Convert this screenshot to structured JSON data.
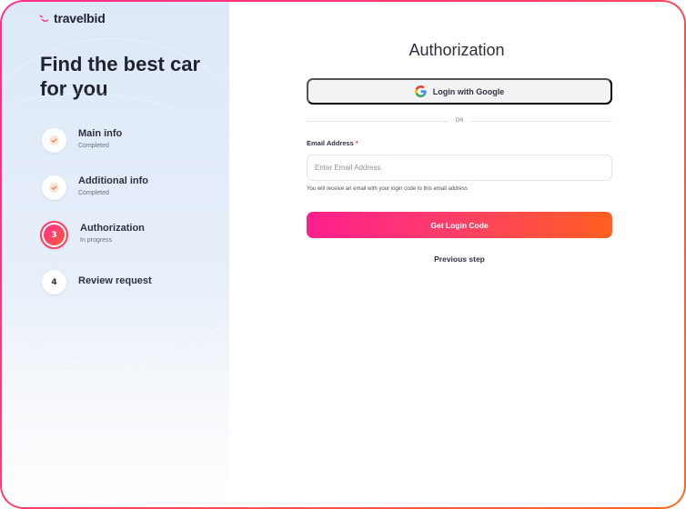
{
  "brand": {
    "name": "travelbid",
    "accent": "#ff3c63",
    "gradient_start": "#ff1f8e",
    "gradient_end": "#ff5f20"
  },
  "sidebar": {
    "headline": "Find the best car for you",
    "steps": [
      {
        "label": "Main info",
        "status": "Completed",
        "marker": "check-icon"
      },
      {
        "label": "Additional info",
        "status": "Completed",
        "marker": "check-icon"
      },
      {
        "label": "Authorization",
        "status": "In progress",
        "marker": "3"
      },
      {
        "label": "Review request",
        "status": "",
        "marker": "4"
      }
    ]
  },
  "main": {
    "title": "Authorization",
    "google_button": {
      "label": "Login with Google",
      "icon": "google-icon"
    },
    "divider_text": "OR",
    "email": {
      "label": "Email Address",
      "required_mark": "*",
      "placeholder": "Enter Email Address",
      "value": "",
      "hint": "You will receive an email with your login code to this email address"
    },
    "submit_label": "Get Login Code",
    "previous_label": "Previous step"
  }
}
